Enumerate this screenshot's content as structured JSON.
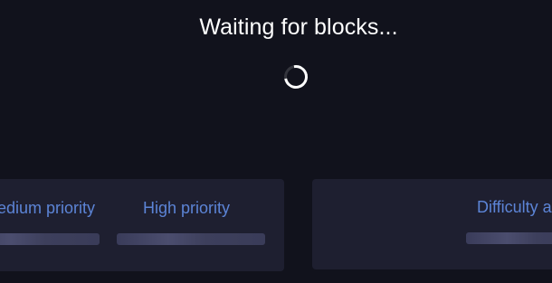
{
  "header": {
    "waiting_text": "Waiting for blocks..."
  },
  "fees_card": {
    "columns": [
      {
        "label": "Medium priority"
      },
      {
        "label": "High priority"
      }
    ]
  },
  "difficulty_card": {
    "label": "Difficulty adjustment"
  },
  "colors": {
    "background": "#11121c",
    "card": "#1e1f30",
    "label_accent": "#5c84d6",
    "skeleton": "#3a3c5a"
  },
  "icons": {
    "loading": "loading-spinner-icon"
  }
}
